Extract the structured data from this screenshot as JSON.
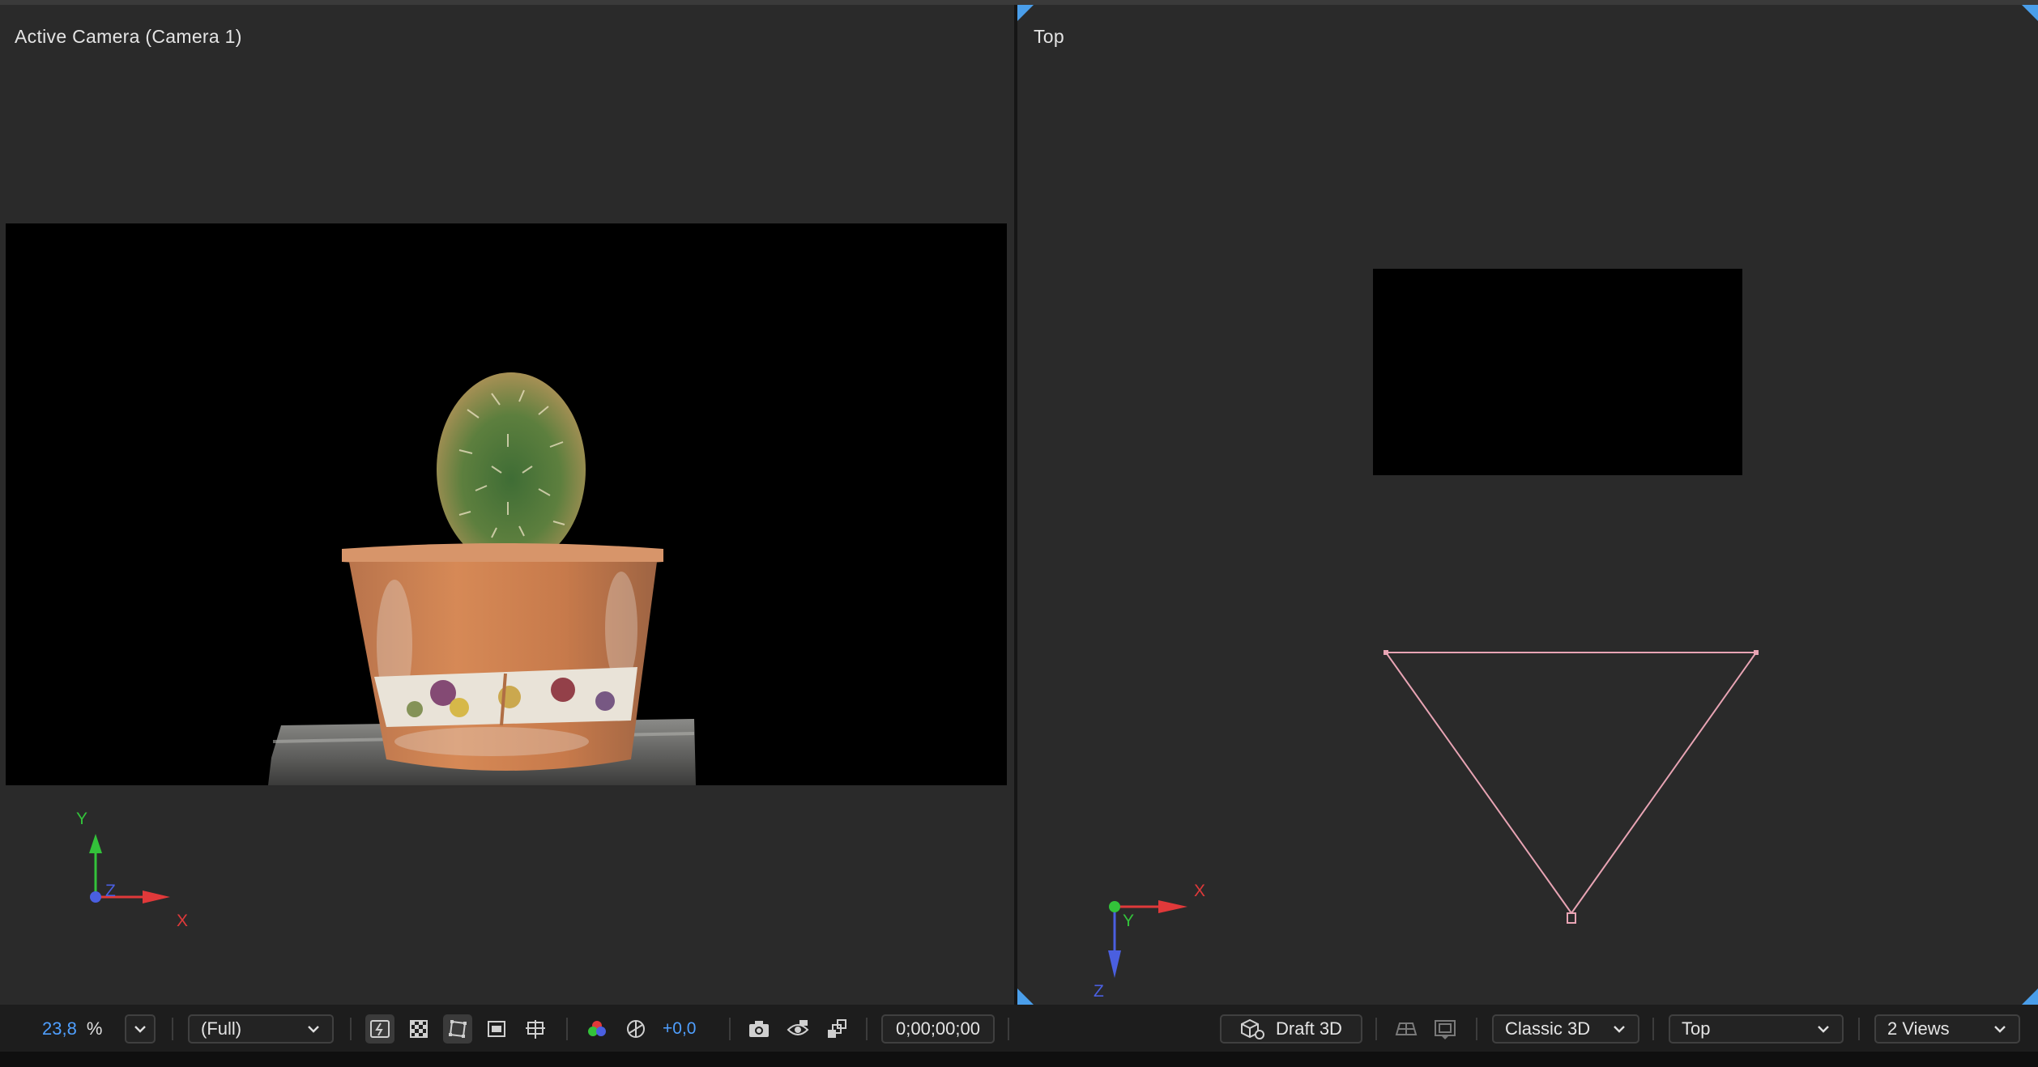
{
  "viewers": {
    "left": {
      "label": "Active Camera (Camera 1)"
    },
    "right": {
      "label": "Top"
    }
  },
  "axes_left": {
    "y": "Y",
    "z": "Z",
    "x": "X"
  },
  "axes_right": {
    "x": "X",
    "y": "Y",
    "z": "Z"
  },
  "toolbar": {
    "zoom_value": "23,8",
    "zoom_unit": "%",
    "resolution": "(Full)",
    "exposure": "+0,0",
    "timecode": "0;00;00;00",
    "draft_3d": "Draft 3D",
    "renderer": "Classic 3D",
    "view": "Top",
    "view_layout": "2 Views"
  },
  "icons": [
    "chevron-down-icon",
    "fast-previews-icon",
    "transparency-grid-icon",
    "mask-visibility-icon",
    "region-of-interest-icon",
    "grid-guides-icon",
    "color-channels-icon",
    "exposure-reset-icon",
    "snapshot-icon",
    "show-snapshot-icon",
    "color-management-icon",
    "draft-3d-icon",
    "3d-ground-plane-icon",
    "extended-viewer-icon"
  ],
  "colors": {
    "panel_bg": "#2a2a2a",
    "accent_blue": "#4f9fff",
    "axis_x": "#e0393a",
    "axis_y": "#33c23a",
    "axis_z": "#4a5fe0",
    "camera_wire": "#e8a4b4"
  }
}
